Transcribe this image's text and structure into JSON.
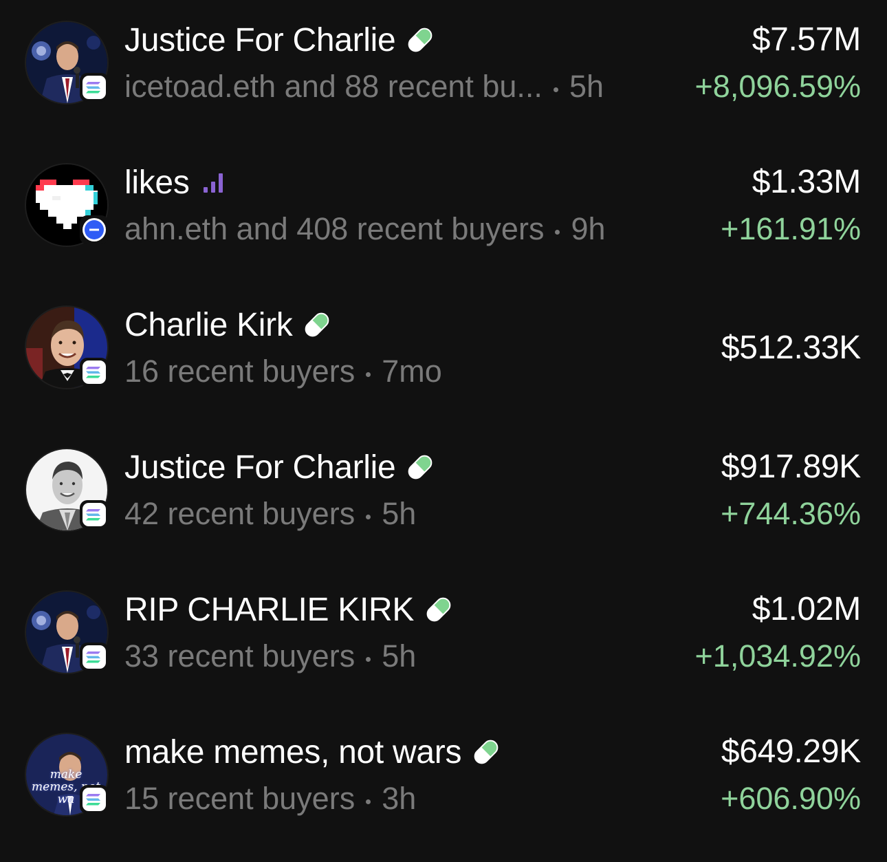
{
  "tokens": [
    {
      "name": "Justice For Charlie",
      "title_icon": "pill-icon",
      "chain_icon": "solana-icon",
      "avatar": "charlie-speaking-avatar",
      "buyers": "icetoad.eth and 88 recent bu...",
      "age": "5h",
      "market_cap": "$7.57M",
      "change": "+8,096.59%"
    },
    {
      "name": "likes",
      "title_icon": "signal-bars-icon",
      "chain_icon": "base-icon",
      "avatar": "pixel-heart-avatar",
      "buyers": "ahn.eth and 408 recent buyers",
      "age": "9h",
      "market_cap": "$1.33M",
      "change": "+161.91%"
    },
    {
      "name": "Charlie Kirk",
      "title_icon": "pill-icon",
      "chain_icon": "solana-icon",
      "avatar": "charlie-smiling-avatar",
      "buyers": "16 recent buyers",
      "age": "7mo",
      "market_cap": "$512.33K",
      "change": ""
    },
    {
      "name": "Justice For Charlie",
      "title_icon": "pill-icon",
      "chain_icon": "solana-icon",
      "avatar": "charlie-portrait-bw-avatar",
      "buyers": "42 recent buyers",
      "age": "5h",
      "market_cap": "$917.89K",
      "change": "+744.36%"
    },
    {
      "name": "RIP CHARLIE KIRK",
      "title_icon": "pill-icon",
      "chain_icon": "solana-icon",
      "avatar": "charlie-speaking-avatar",
      "buyers": "33 recent buyers",
      "age": "5h",
      "market_cap": "$1.02M",
      "change": "+1,034.92%"
    },
    {
      "name": "make memes, not wars",
      "title_icon": "pill-icon",
      "chain_icon": "solana-icon",
      "avatar": "make-memes-avatar",
      "avatar_text": "make memes, not wa",
      "buyers": "15 recent buyers",
      "age": "3h",
      "market_cap": "$649.29K",
      "change": "+606.90%"
    }
  ],
  "colors": {
    "background": "#111111",
    "title": "#ffffff",
    "secondary": "#7a7a7a",
    "positive": "#8fd39b",
    "pill_green": "#7fd48f",
    "bars_purple": "#8a63d2",
    "base_blue": "#2f5cf5"
  }
}
